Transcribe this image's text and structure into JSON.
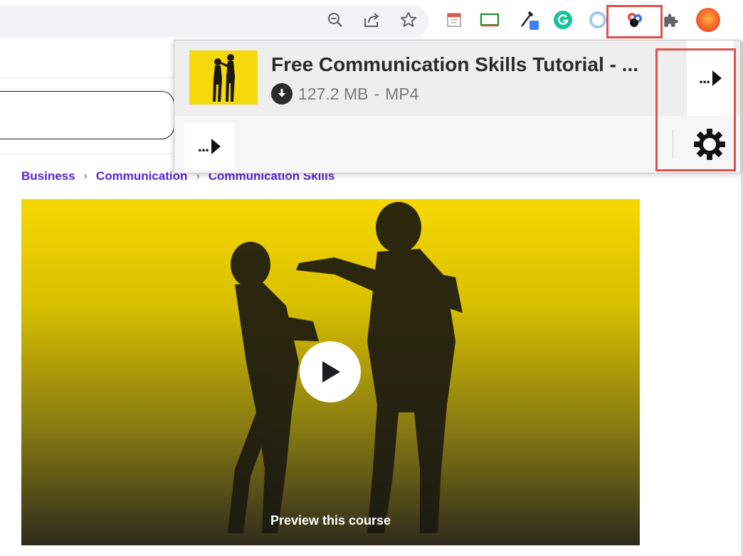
{
  "browser": {
    "toolbar_icons": [
      "zoom-out-icon",
      "share-icon",
      "bookmark-star-icon"
    ],
    "extension_icons": [
      "notes-extension-icon",
      "screen-capture-extension-icon",
      "color-picker-extension-icon",
      "grammarly-extension-icon",
      "ring-extension-icon",
      "video-downloader-extension-icon",
      "extensions-puzzle-icon",
      "profile-avatar"
    ],
    "highlight_color": "#d9534f",
    "grammarly_color": "#15c39a",
    "avatar_color": "#f4732a"
  },
  "page": {
    "breadcrumb": [
      "Business",
      "Communication",
      "Communication Skills"
    ],
    "breadcrumb_separator": "›",
    "breadcrumb_color": "#5624d0",
    "preview": {
      "label": "Preview this course",
      "gradient_top": "#f6d800",
      "gradient_bottom": "#2e2b1c"
    }
  },
  "popup": {
    "item": {
      "title": "Free Communication Skills Tutorial - ...",
      "size": "127.2 MB",
      "separator": "-",
      "format": "MP4",
      "more_menu": "..."
    },
    "footer": {
      "more_menu": "..."
    }
  }
}
